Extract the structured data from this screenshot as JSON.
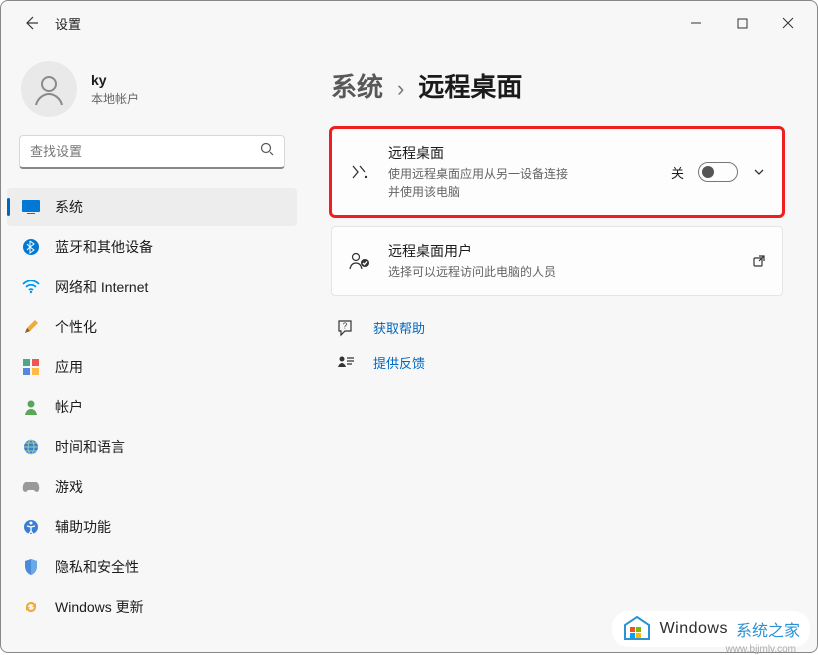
{
  "titlebar": {
    "title": "设置"
  },
  "user": {
    "name": "ky",
    "subtitle": "本地帐户"
  },
  "search": {
    "placeholder": "查找设置"
  },
  "nav": {
    "items": [
      {
        "label": "系统"
      },
      {
        "label": "蓝牙和其他设备"
      },
      {
        "label": "网络和 Internet"
      },
      {
        "label": "个性化"
      },
      {
        "label": "应用"
      },
      {
        "label": "帐户"
      },
      {
        "label": "时间和语言"
      },
      {
        "label": "游戏"
      },
      {
        "label": "辅助功能"
      },
      {
        "label": "隐私和安全性"
      },
      {
        "label": "Windows 更新"
      }
    ]
  },
  "breadcrumb": {
    "parent": "系统",
    "sep": "›",
    "current": "远程桌面"
  },
  "cards": {
    "remote": {
      "title": "远程桌面",
      "desc": "使用远程桌面应用从另一设备连接并使用该电脑",
      "toggle_label": "关"
    },
    "users": {
      "title": "远程桌面用户",
      "desc": "选择可以远程访问此电脑的人员"
    }
  },
  "links": {
    "help": "获取帮助",
    "feedback": "提供反馈"
  },
  "watermark": {
    "brand": "Windows",
    "suffix": "系统之家",
    "url": "www.bjjmlv.com"
  }
}
